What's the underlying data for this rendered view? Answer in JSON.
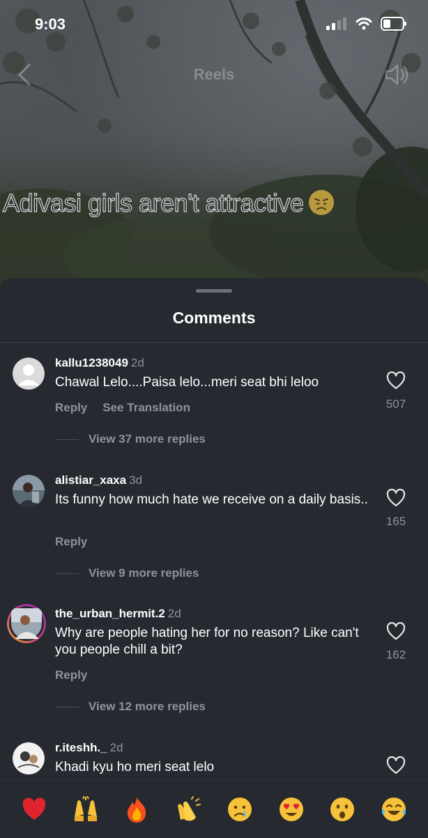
{
  "status_bar": {
    "time": "9:03"
  },
  "reels_nav": {
    "title": "Reels"
  },
  "video": {
    "overlay_text": "Adivasi girls aren't attractive"
  },
  "sheet": {
    "title": "Comments"
  },
  "comments": [
    {
      "username": "kallu1238049",
      "time": "2d",
      "text": "Chawal Lelo....Paisa lelo...meri seat bhi leloo",
      "reply_label": "Reply",
      "translation_label": "See Translation",
      "likes": "507",
      "view_replies": "View 37 more replies"
    },
    {
      "username": "alistiar_xaxa",
      "time": "3d",
      "text": "Its funny how much hate we receive on a daily basis..",
      "reply_label": "Reply",
      "likes": "165",
      "view_replies": "View 9 more replies"
    },
    {
      "username": "the_urban_hermit.2",
      "time": "2d",
      "text": "Why are people hating her for no reason? Like can't you people chill a bit?",
      "reply_label": "Reply",
      "likes": "162",
      "view_replies": "View 12 more replies"
    },
    {
      "username": "r.iteshh._",
      "time": "2d",
      "text": "Khadi kyu ho meri seat lelo"
    }
  ],
  "emoji_bar": [
    "red-heart-icon",
    "raising-hands-icon",
    "fire-icon",
    "clapping-hands-icon",
    "crying-face-icon",
    "heart-eyes-icon",
    "surprised-face-icon",
    "tears-of-joy-icon"
  ],
  "colors": {
    "sheet_bg": "#262a30",
    "muted_text": "#8e939a",
    "story_ring": "#c13584"
  }
}
